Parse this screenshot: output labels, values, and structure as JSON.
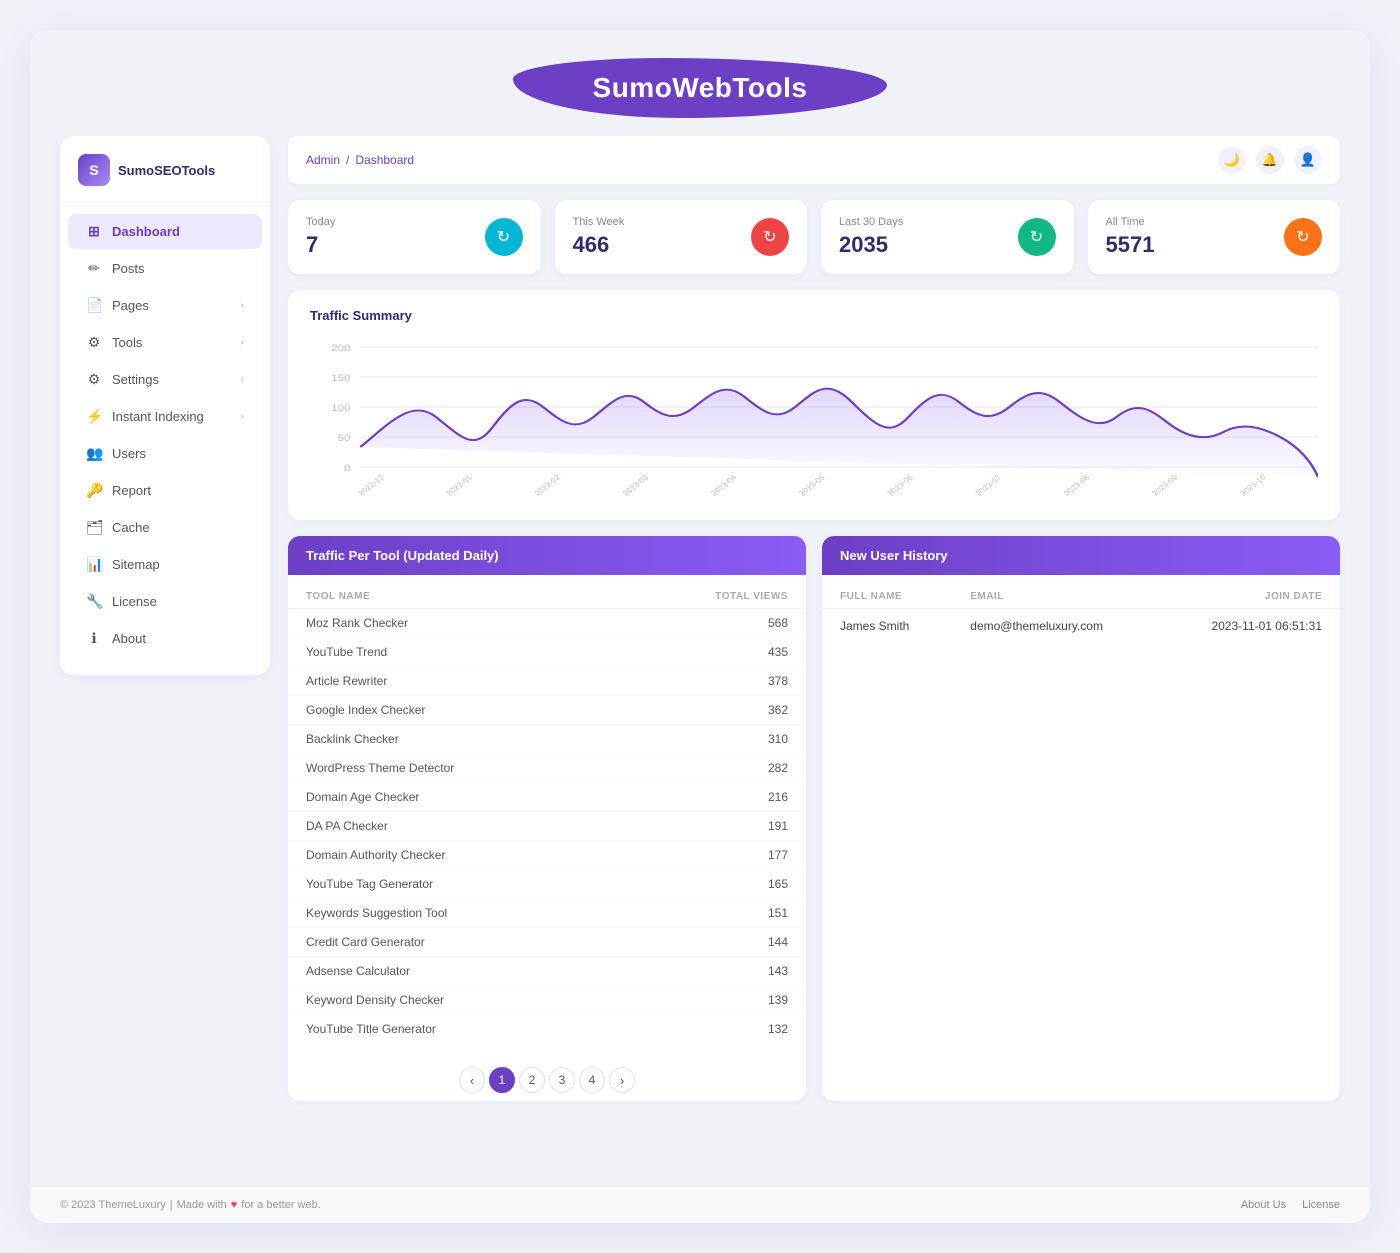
{
  "banner": {
    "title": "SumoWebTools"
  },
  "sidebar": {
    "logo_text": "SumoSEOTools",
    "items": [
      {
        "id": "dashboard",
        "label": "Dashboard",
        "icon": "⊞",
        "active": true,
        "has_chevron": false
      },
      {
        "id": "posts",
        "label": "Posts",
        "icon": "✏",
        "active": false,
        "has_chevron": false
      },
      {
        "id": "pages",
        "label": "Pages",
        "icon": "📄",
        "active": false,
        "has_chevron": true
      },
      {
        "id": "tools",
        "label": "Tools",
        "icon": "⚙",
        "active": false,
        "has_chevron": true
      },
      {
        "id": "settings",
        "label": "Settings",
        "icon": "⚙",
        "active": false,
        "has_chevron": true
      },
      {
        "id": "instant-indexing",
        "label": "Instant Indexing",
        "icon": "⚡",
        "active": false,
        "has_chevron": true
      },
      {
        "id": "users",
        "label": "Users",
        "icon": "👥",
        "active": false,
        "has_chevron": false
      },
      {
        "id": "report",
        "label": "Report",
        "icon": "🔑",
        "active": false,
        "has_chevron": false
      },
      {
        "id": "cache",
        "label": "Cache",
        "icon": "🗂",
        "active": false,
        "has_chevron": false
      },
      {
        "id": "sitemap",
        "label": "Sitemap",
        "icon": "📊",
        "active": false,
        "has_chevron": false
      },
      {
        "id": "license",
        "label": "License",
        "icon": "🔧",
        "active": false,
        "has_chevron": false
      },
      {
        "id": "about",
        "label": "About",
        "icon": "ℹ",
        "active": false,
        "has_chevron": false
      }
    ]
  },
  "breadcrumb": {
    "admin": "Admin",
    "separator": "/",
    "current": "Dashboard"
  },
  "stat_cards": [
    {
      "label": "Today",
      "value": "7",
      "icon": "↻",
      "icon_bg": "#06b6d4"
    },
    {
      "label": "This Week",
      "value": "466",
      "icon": "↻",
      "icon_bg": "#ef4444"
    },
    {
      "label": "Last 30 Days",
      "value": "2035",
      "icon": "↻",
      "icon_bg": "#10b981"
    },
    {
      "label": "All Time",
      "value": "5571",
      "icon": "↻",
      "icon_bg": "#f97316"
    }
  ],
  "chart": {
    "title": "Traffic Summary",
    "y_labels": [
      "200",
      "150",
      "100",
      "50",
      "0"
    ],
    "x_labels": [
      "2022-12",
      "2022-12",
      "2022-12",
      "2023-01",
      "2023-01",
      "2023-01",
      "2023-02",
      "2023-02",
      "2023-02",
      "2023-03",
      "2023-03",
      "2023-03",
      "2023-04",
      "2023-04",
      "2023-04",
      "2023-05",
      "2023-05",
      "2023-05",
      "2023-06",
      "2023-06",
      "2023-06",
      "2023-07",
      "2023-07",
      "2023-07",
      "2023-08",
      "2023-08",
      "2023-08",
      "2023-09",
      "2023-09",
      "2023-09",
      "2023-10",
      "2023-10",
      "2023-10"
    ]
  },
  "traffic_table": {
    "title": "Traffic Per Tool (Updated Daily)",
    "col_tool": "TOOL NAME",
    "col_views": "TOTAL VIEWS",
    "rows": [
      {
        "tool": "Moz Rank Checker",
        "views": 568
      },
      {
        "tool": "YouTube Trend",
        "views": 435
      },
      {
        "tool": "Article Rewriter",
        "views": 378
      },
      {
        "tool": "Google Index Checker",
        "views": 362
      },
      {
        "tool": "Backlink Checker",
        "views": 310
      },
      {
        "tool": "WordPress Theme Detector",
        "views": 282
      },
      {
        "tool": "Domain Age Checker",
        "views": 216
      },
      {
        "tool": "DA PA Checker",
        "views": 191
      },
      {
        "tool": "Domain Authority Checker",
        "views": 177
      },
      {
        "tool": "YouTube Tag Generator",
        "views": 165
      },
      {
        "tool": "Keywords Suggestion Tool",
        "views": 151
      },
      {
        "tool": "Credit Card Generator",
        "views": 144
      },
      {
        "tool": "Adsense Calculator",
        "views": 143
      },
      {
        "tool": "Keyword Density Checker",
        "views": 139
      },
      {
        "tool": "YouTube Title Generator",
        "views": 132
      }
    ],
    "pagination": {
      "prev": "‹",
      "pages": [
        "1",
        "2",
        "3",
        "4"
      ],
      "next": "›",
      "active_page": 1
    }
  },
  "user_history": {
    "title": "New User History",
    "col_name": "FULL NAME",
    "col_email": "EMAIL",
    "col_date": "JOIN DATE",
    "rows": [
      {
        "name": "James Smith",
        "email": "demo@themeluxury.com",
        "join_date": "2023-11-01 06:51:31"
      }
    ]
  },
  "footer": {
    "copyright": "© 2023 ThemeLuxury",
    "separator": "|",
    "made_with": "Made with",
    "for_web": "for a better web.",
    "links": [
      "About Us",
      "License"
    ]
  }
}
